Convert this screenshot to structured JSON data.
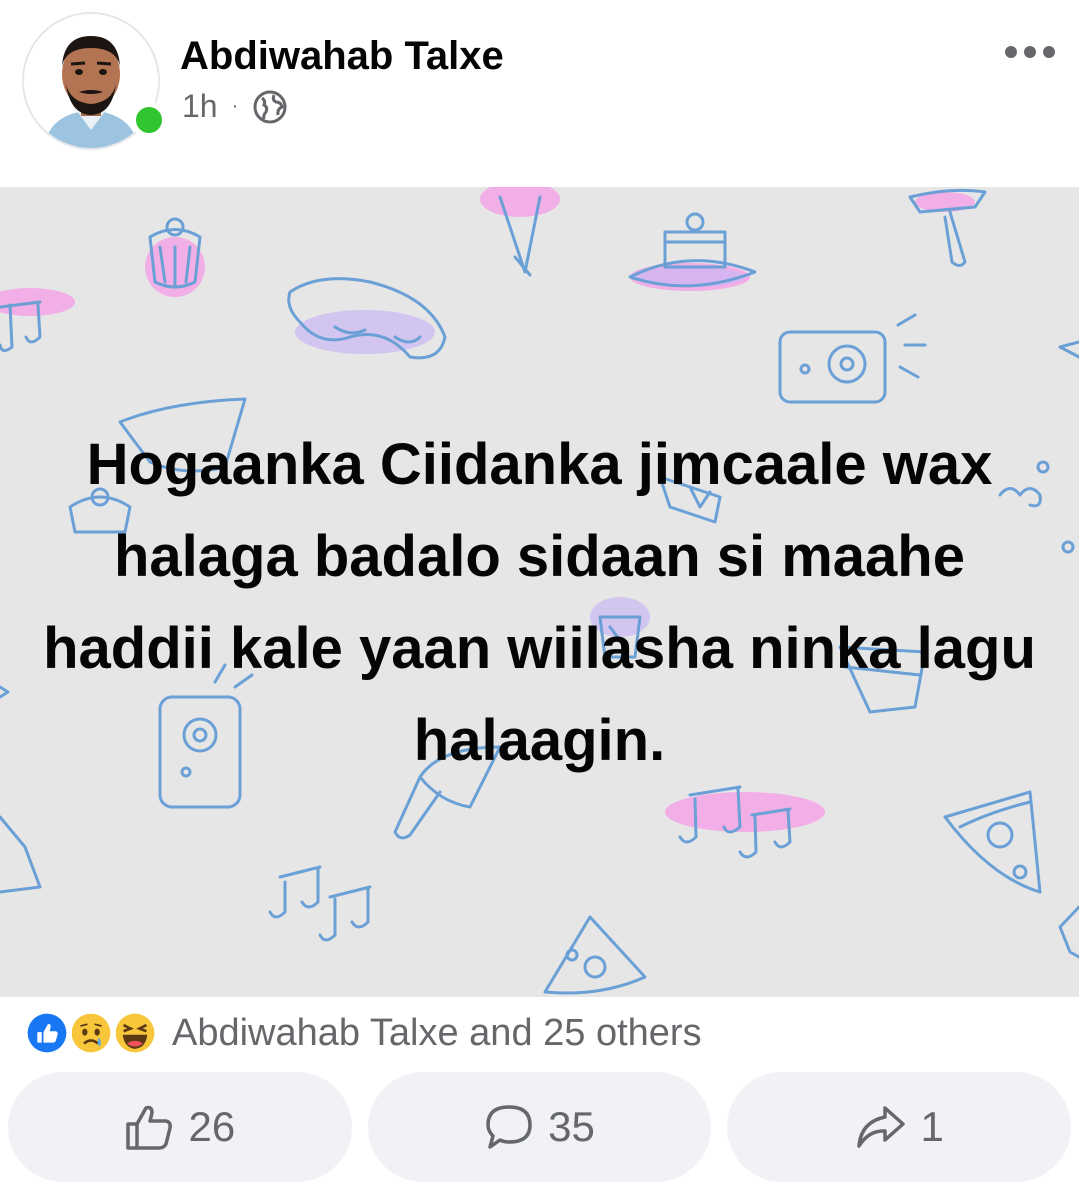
{
  "post": {
    "author": "Abdiwahab Talxe",
    "time": "1h",
    "separator": "·",
    "privacy_icon": "globe-icon",
    "text": "Hogaanka Ciidanka jimcaale wax halaga badalo sidaan si maahe haddii kale yaan wiilasha ninka lagu halaagin.",
    "background_color": "#e6e6e7"
  },
  "reactions": {
    "icons": [
      "like-icon",
      "sad-icon",
      "haha-icon"
    ],
    "summary": "Abdiwahab Talxe and 25 others"
  },
  "actions": {
    "like_count": "26",
    "comment_count": "35",
    "share_count": "1"
  },
  "colors": {
    "online": "#31c631",
    "like_blue": "#1877f2",
    "text_secondary": "#65676b",
    "button_bg": "#f0f2f5"
  }
}
